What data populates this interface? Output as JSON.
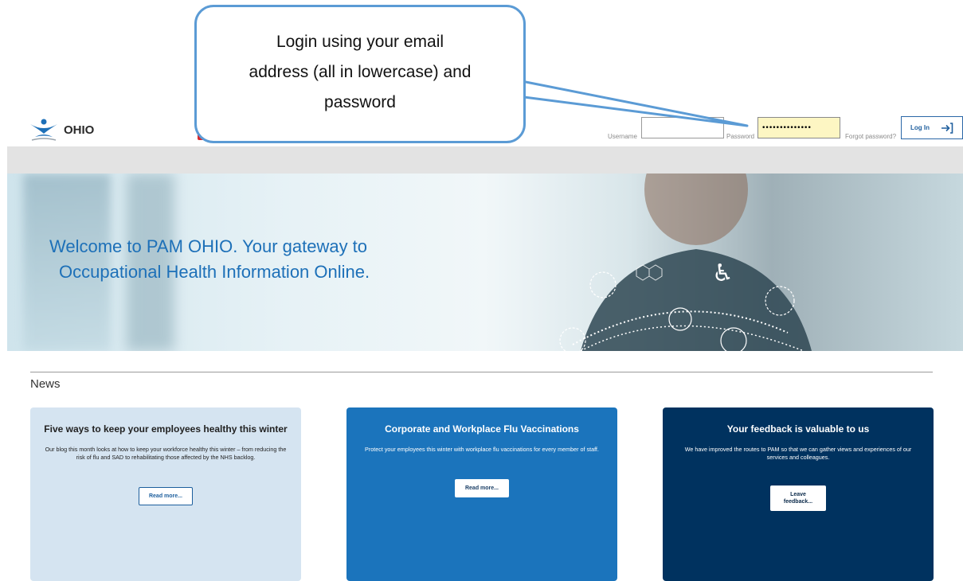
{
  "callout": {
    "lines": [
      "Login using your email",
      "address (all in lowercase) and",
      "password"
    ]
  },
  "header": {
    "logo_text": "OHIO",
    "username_label": "Username",
    "password_label": "Password",
    "username_value": "",
    "password_value": "••••••••••••••",
    "forgot_password": "Forgot password?",
    "login_button": "Log In"
  },
  "hero": {
    "line1": "Welcome to PAM OHIO. Your gateway to",
    "line2": "Occupational Health Information Online."
  },
  "news": {
    "title": "News",
    "cards": [
      {
        "title": "Five ways to keep your employees healthy this winter",
        "body": "Our blog this month looks at how to keep your workforce healthy this winter – from reducing the risk of flu and SAD to rehabilitating those affected by the NHS backlog.",
        "button": "Read more..."
      },
      {
        "title": "Corporate and Workplace Flu Vaccinations",
        "body": "Protect your employees this winter with workplace flu vaccinations for every member of staff.",
        "button": "Read more..."
      },
      {
        "title": "Your feedback is valuable to us",
        "body": "We have improved the routes to PAM so that we can gather views and experiences of our services and colleagues.",
        "button_line1": "Leave",
        "button_line2": "feedback..."
      }
    ]
  },
  "colors": {
    "brand_blue": "#1d70b8",
    "card1_bg": "#d5e4f1",
    "card2_bg": "#1b74bc",
    "card3_bg": "#00325f",
    "password_bg": "#fdf6c3",
    "callout_border": "#5b9bd5"
  },
  "icons": [
    "ohio-logo-icon",
    "login-arrow-icon"
  ]
}
